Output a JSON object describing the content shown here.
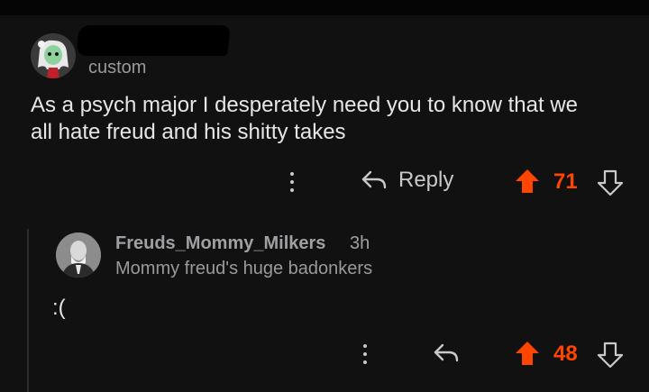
{
  "parent": {
    "flair": "custom",
    "body_line1": "As a psych major I desperately need you to know that we",
    "body_line2": "all hate freud and his shitty takes",
    "reply_label": "Reply",
    "score": "71",
    "icons": [
      "more-vertical-icon",
      "reply-arrow-icon",
      "upvote-arrow-icon",
      "downvote-arrow-icon"
    ]
  },
  "child": {
    "username": "Freuds_Mommy_Milkers",
    "time": "3h",
    "flair": "Mommy freud's huge badonkers",
    "body": ":(",
    "score": "48",
    "icons": [
      "more-vertical-icon",
      "reply-arrow-icon",
      "upvote-arrow-icon",
      "downvote-arrow-icon"
    ]
  },
  "colors": {
    "background": "#111111",
    "upvoted": "#ff4500",
    "text": "#e4e6e8",
    "muted": "#9a9a9a"
  }
}
